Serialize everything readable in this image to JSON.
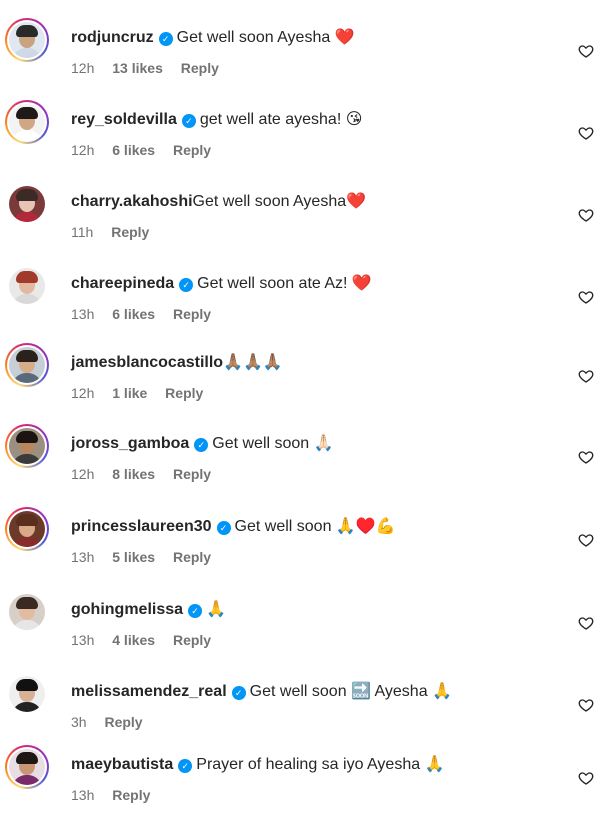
{
  "comments": [
    {
      "username": "rodjuncruz",
      "verified": true,
      "text": "Get well soon Ayesha ❤️",
      "time": "12h",
      "likes": "13 likes",
      "reply": "Reply",
      "avatar": {
        "skin": "#c9a27e",
        "hair": "#2a2a2a",
        "shirt": "#cfd8e6",
        "bg": "#dfe7f1"
      }
    },
    {
      "username": "rey_soldevilla",
      "verified": true,
      "text": "get well ate ayesha! 😘",
      "time": "12h",
      "likes": "6 likes",
      "reply": "Reply",
      "avatar": {
        "skin": "#d1a684",
        "hair": "#1f1a17",
        "shirt": "#ffffff",
        "bg": "#f3f3f3"
      }
    },
    {
      "username": "charry.akahoshi",
      "verified": false,
      "text": "Get well soon Ayesha❤️",
      "time": "11h",
      "likes": "",
      "reply": "Reply",
      "avatar": {
        "skin": "#e8c4b4",
        "hair": "#3c2a26",
        "shirt": "#b3283a",
        "bg": "#7a3a3a"
      }
    },
    {
      "username": "chareepineda",
      "verified": true,
      "text": "Get well soon ate Az! ❤️",
      "time": "13h",
      "likes": "6 likes",
      "reply": "Reply",
      "avatar": {
        "skin": "#e3b8a0",
        "hair": "#a23a2c",
        "shirt": "#d9d9d9",
        "bg": "#e9e9e9"
      }
    },
    {
      "username": "jamesblancocastillo",
      "verified": false,
      "text": "🙏🏽🙏🏽🙏🏽",
      "time": "12h",
      "likes": "1 like",
      "reply": "Reply",
      "avatar": {
        "skin": "#d6ad8a",
        "hair": "#2b211b",
        "shirt": "#5a6a7a",
        "bg": "#c6cfd6"
      }
    },
    {
      "username": "joross_gamboa",
      "verified": true,
      "text": "Get well soon 🙏🏻",
      "time": "12h",
      "likes": "8 likes",
      "reply": "Reply",
      "avatar": {
        "skin": "#b8865f",
        "hair": "#1b1410",
        "shirt": "#3b3b3b",
        "bg": "#9a8f80"
      }
    },
    {
      "username": "princesslaureen30",
      "verified": true,
      "text": "Get well soon 🙏♥️💪",
      "time": "13h",
      "likes": "5 likes",
      "reply": "Reply",
      "avatar": {
        "skin": "#d9a98a",
        "hair": "#5a2f1e",
        "shirt": "#8a2b2b",
        "bg": "#6b3a2a"
      }
    },
    {
      "username": "gohingmelissa",
      "verified": true,
      "text": "🙏",
      "time": "13h",
      "likes": "4 likes",
      "reply": "Reply",
      "avatar": {
        "skin": "#e2bca0",
        "hair": "#3b2a22",
        "shirt": "#e6e6e6",
        "bg": "#d7d0c8"
      }
    },
    {
      "username": "melissamendez_real",
      "verified": true,
      "text": "Get well soon 🔜 Ayesha 🙏",
      "time": "3h",
      "likes": "",
      "reply": "Reply",
      "avatar": {
        "skin": "#d8b095",
        "hair": "#111111",
        "shirt": "#222222",
        "bg": "#efefef"
      }
    },
    {
      "username": "maeybautista",
      "verified": true,
      "text": "Prayer of healing sa iyo Ayesha 🙏",
      "time": "13h",
      "likes": "",
      "reply": "Reply",
      "avatar": {
        "skin": "#c99774",
        "hair": "#1e1714",
        "shirt": "#7a2a6a",
        "bg": "#e6dde5"
      }
    }
  ]
}
